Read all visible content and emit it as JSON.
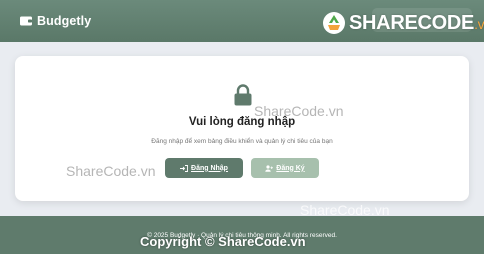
{
  "header": {
    "brand_name": "Budgetly",
    "brand_icon": "wallet-icon"
  },
  "watermark": {
    "logo_text": "SHARECODE",
    "logo_suffix": ".vn",
    "overlay_1": "ShareCode.vn",
    "overlay_2": "ShareCode.vn",
    "overlay_3": "ShareCode.vn",
    "copyright": "Copyright © ShareCode.vn"
  },
  "card": {
    "icon": "lock-icon",
    "title": "Vui lòng đăng nhập",
    "subtitle": "Đăng nhập để xem bảng điều khiển và quản lý chi tiêu của bạn",
    "login_label": "Đăng Nhập",
    "register_label": "Đăng Ký"
  },
  "footer": {
    "text": "© 2025 Budgetly · Quản lý chi tiêu thông minh. All rights reserved."
  },
  "colors": {
    "header": "#5a7868",
    "primary_button": "#5f7a6c",
    "secondary_button": "#a7c0ad",
    "footer": "#5f7b6c"
  }
}
